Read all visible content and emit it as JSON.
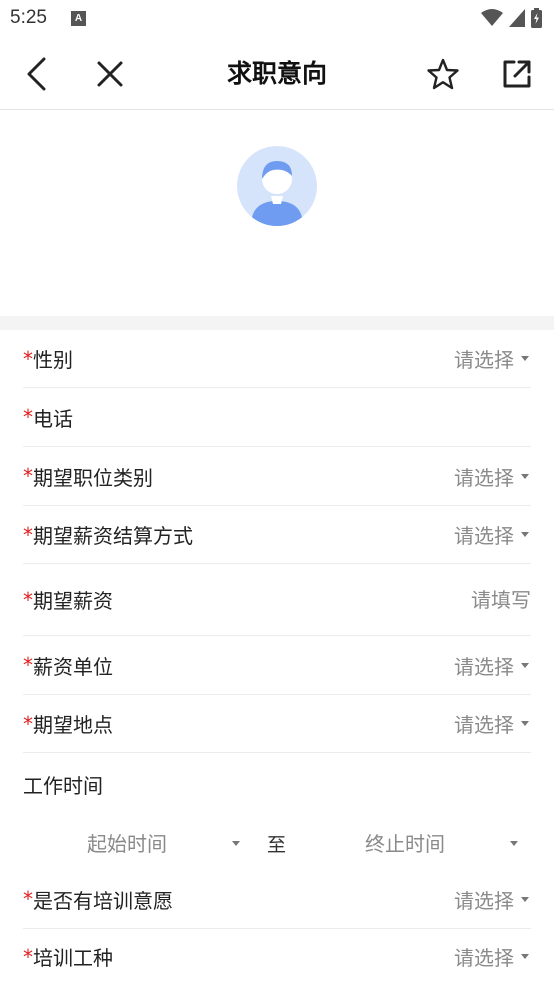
{
  "status_bar": {
    "time": "5:25",
    "app_icon_letter": "A"
  },
  "header": {
    "title": "求职意向",
    "back_icon": "chevron-left-icon",
    "close_icon": "close-icon",
    "favorite_icon": "star-icon",
    "share_icon": "external-link-icon"
  },
  "form": {
    "required_mark": "*",
    "fields": [
      {
        "label": "性别",
        "value": "请选择",
        "type": "select",
        "required": true
      },
      {
        "label": "电话",
        "value": "",
        "type": "input",
        "required": true
      },
      {
        "label": "期望职位类别",
        "value": "请选择",
        "type": "select",
        "required": true
      },
      {
        "label": "期望薪资结算方式",
        "value": "请选择",
        "type": "select",
        "required": true
      },
      {
        "label": "期望薪资",
        "value": "请填写",
        "type": "input",
        "required": true
      },
      {
        "label": "薪资单位",
        "value": "请选择",
        "type": "select",
        "required": true
      },
      {
        "label": "期望地点",
        "value": "请选择",
        "type": "select",
        "required": true
      },
      {
        "label": "是否有培训意愿",
        "value": "请选择",
        "type": "select",
        "required": true
      },
      {
        "label": "培训工种",
        "value": "请选择",
        "type": "select",
        "required": true
      }
    ],
    "work_time": {
      "label": "工作时间",
      "start": "起始时间",
      "to": "至",
      "end": "终止时间"
    }
  },
  "colors": {
    "required": "#e02020",
    "placeholder": "#8a8a8a",
    "avatar_bg": "#d6e4fb",
    "avatar_fg": "#6f9cf0"
  }
}
